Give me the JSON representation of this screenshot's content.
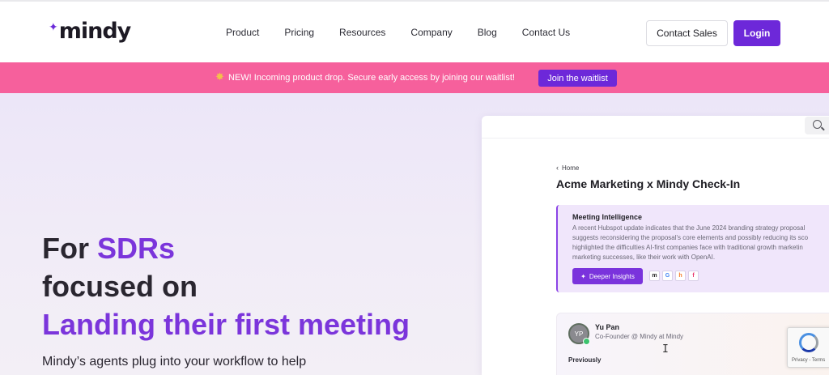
{
  "brand": {
    "name": "mindy",
    "spark": "✦"
  },
  "nav": {
    "links": [
      "Product",
      "Pricing",
      "Resources",
      "Company",
      "Blog",
      "Contact Us"
    ],
    "contact_sales": "Contact Sales",
    "login": "Login"
  },
  "banner": {
    "icon": "✸",
    "text": "NEW! Incoming product drop. Secure early access by joining our waitlist!",
    "cta": "Join the waitlist"
  },
  "hero": {
    "line1_prefix": "For ",
    "line1_accent": "SDRs",
    "line2": "focused on",
    "line3": "Landing their first meeting",
    "subtitle": "Mindy’s agents plug into your workflow to help"
  },
  "preview": {
    "breadcrumb": "Home",
    "title": "Acme Marketing x Mindy Check-In",
    "meeting_intelligence": {
      "title": "Meeting Intelligence",
      "lines": [
        "A recent Hubspot update indicates that the June 2024 branding strategy proposal",
        "suggests reconsidering the proposal's core elements and possibly reducing its sco",
        "highlighted the difficulties AI-first companies face with traditional growth marketin",
        "marketing successes, like their work with OpenAI."
      ],
      "button": "Deeper Insights",
      "logos": [
        "m",
        "G",
        "h",
        "f"
      ]
    },
    "note": {
      "initials": "YP",
      "name": "Yu Pan",
      "role": "Co-Founder @ Mindy at Mindy",
      "previous_label": "Previously"
    }
  },
  "recaptcha": {
    "text": "Privacy - Terms"
  },
  "icons": [
    "search-icon",
    "sparkle-icon",
    "chevron-left-icon",
    "recaptcha-icon"
  ],
  "colors": {
    "brand_purple": "#6d28d9",
    "banner_pink": "#f6609c",
    "accent_purple": "#7b35db"
  }
}
